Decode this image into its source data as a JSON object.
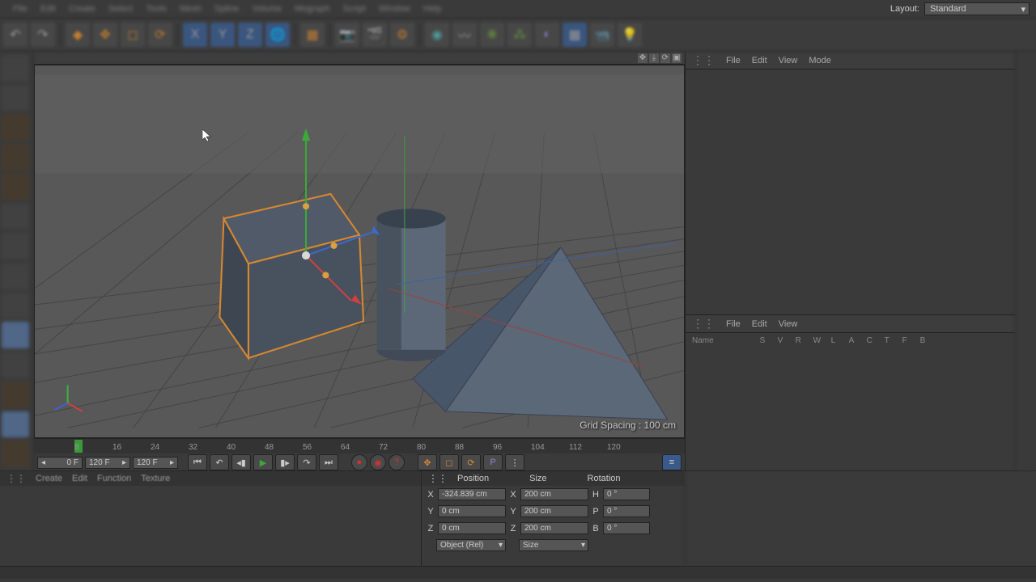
{
  "top_menu": [
    "File",
    "Edit",
    "Create",
    "Select",
    "Tools",
    "Mesh",
    "Spline",
    "Volume",
    "Mograph",
    "Script",
    "Window",
    "Help"
  ],
  "layout": {
    "label": "Layout:",
    "value": "Standard"
  },
  "objects_panel": {
    "menu": [
      "File",
      "Edit",
      "View",
      "Mode"
    ]
  },
  "attributes_panel": {
    "menu": [
      "File",
      "Edit",
      "View"
    ],
    "name_label": "Name",
    "cols": [
      "S",
      "V",
      "R",
      "W",
      "L",
      "A",
      "C",
      "T",
      "F",
      "B"
    ]
  },
  "viewport": {
    "grid_label": "Grid Spacing : 100 cm"
  },
  "timeline": {
    "frame_a": "0 F",
    "frame_b": "120 F",
    "frame_c": "120 F",
    "ticks": [
      8,
      16,
      24,
      32,
      40,
      48,
      56,
      64,
      72,
      80,
      88,
      96,
      104,
      112,
      120
    ],
    "cur": "0 F"
  },
  "material_tabs": [
    "Create",
    "Edit",
    "Function",
    "Texture"
  ],
  "coord": {
    "headers": [
      "Position",
      "Size",
      "Rotation"
    ],
    "rows": [
      {
        "axis": "X",
        "pos": "-324.839 cm",
        "saxis": "X",
        "size": "200 cm",
        "raxis": "H",
        "rot": "0 °"
      },
      {
        "axis": "Y",
        "pos": "0 cm",
        "saxis": "Y",
        "size": "200 cm",
        "raxis": "P",
        "rot": "0 °"
      },
      {
        "axis": "Z",
        "pos": "0 cm",
        "saxis": "Z",
        "size": "200 cm",
        "raxis": "B",
        "rot": "0 °"
      }
    ],
    "mode": "Object (Rel)",
    "size_mode": "Size"
  }
}
